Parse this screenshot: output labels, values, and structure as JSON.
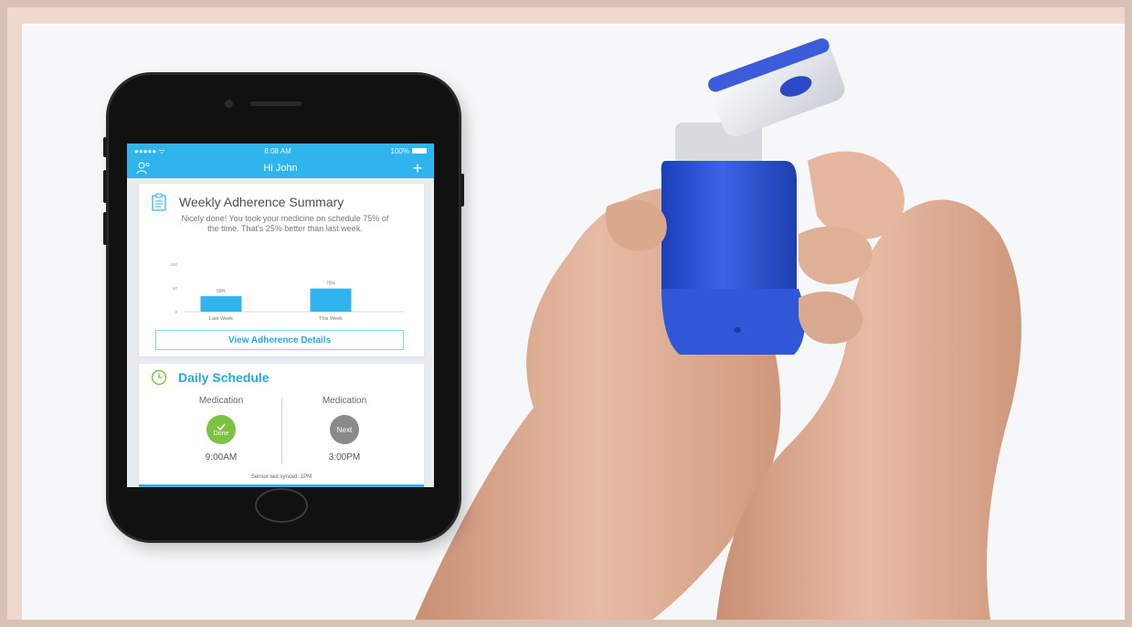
{
  "phone": {
    "status_bar": {
      "signal": "●●●●● ᯤ",
      "time": "8:08 AM",
      "battery": "100%"
    },
    "nav": {
      "title": "Hi John",
      "add": "+"
    },
    "summary": {
      "title": "Weekly Adherence Summary",
      "text": "Nicely done! You took your medicine on schedule 75% of the time. That's 25% better than last week.",
      "button_label": "View Adherence Details"
    },
    "schedule": {
      "title": "Daily Schedule",
      "doses": [
        {
          "label": "Medication",
          "status": "Done",
          "circle_color": "#7cc242",
          "time": "9:00AM"
        },
        {
          "label": "Medication",
          "status": "Next",
          "circle_color": "#8a8a8a",
          "time": "3:00PM"
        }
      ],
      "sync_text": "Sensor last synced: 1PM"
    }
  },
  "chart_data": {
    "type": "bar",
    "categories": [
      "Last Week",
      "This Week"
    ],
    "values": [
      50,
      75
    ],
    "data_labels": [
      "50%",
      "75%"
    ],
    "ytick_labels": [
      "100",
      "50",
      "0"
    ],
    "ylim": [
      0,
      100
    ],
    "bar_color": "#30b4ee",
    "grid": false
  },
  "colors": {
    "accent": "#30b4ee",
    "inhaler_blue": "#2f57d8",
    "skin": "#dcae95"
  }
}
